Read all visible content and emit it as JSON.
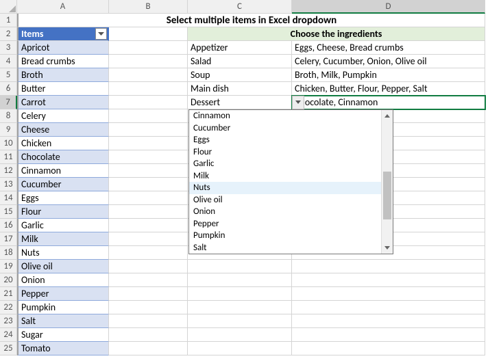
{
  "columns": [
    "A",
    "B",
    "C",
    "D"
  ],
  "title": "Select multiple items in Excel dropdown",
  "items_header": "Items",
  "choose_header": "Choose the ingredients",
  "items": [
    "Apricot",
    "Bread crumbs",
    "Broth",
    "Butter",
    "Carrot",
    "Celery",
    "Cheese",
    "Chicken",
    "Chocolate",
    "Cinnamon",
    "Cucumber",
    "Eggs",
    "Flour",
    "Garlic",
    "Milk",
    "Nuts",
    "Olive oil",
    "Onion",
    "Pepper",
    "Pumpkin",
    "Salt",
    "Sugar",
    "Tomato"
  ],
  "courses": [
    {
      "label": "Appetizer",
      "ingredients": "Eggs, Cheese, Bread crumbs"
    },
    {
      "label": "Salad",
      "ingredients": "Celery, Cucumber, Onion, Olive oil"
    },
    {
      "label": "Soup",
      "ingredients": "Broth, Milk, Pumpkin"
    },
    {
      "label": "Main dish",
      "ingredients": "Chicken, Butter, Flour, Pepper, Salt"
    },
    {
      "label": "Dessert",
      "ingredients": "Chocolate, Cinnamon"
    }
  ],
  "dropdown": {
    "options": [
      "Cinnamon",
      "Cucumber",
      "Eggs",
      "Flour",
      "Garlic",
      "Milk",
      "Nuts",
      "Olive oil",
      "Onion",
      "Pepper",
      "Pumpkin",
      "Salt"
    ],
    "hover_index": 6
  },
  "active": {
    "col_index": 3,
    "row": 7
  },
  "row_count": 25
}
